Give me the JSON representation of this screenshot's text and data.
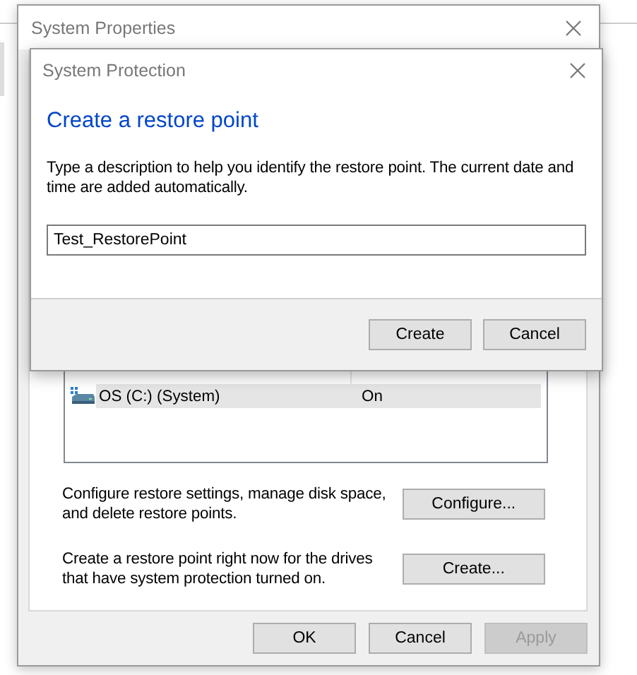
{
  "system_properties": {
    "title": "System Properties",
    "drives_table": {
      "rows": [
        {
          "drive": "OS (C:) (System)",
          "protection": "On",
          "selected": true
        }
      ]
    },
    "configure_text": "Configure restore settings, manage disk space, and delete restore points.",
    "configure_button": "Configure...",
    "create_text": "Create a restore point right now for the drives that have system protection turned on.",
    "create_button": "Create...",
    "buttons": [
      {
        "label": "OK",
        "disabled": false
      },
      {
        "label": "Cancel",
        "disabled": false
      },
      {
        "label": "Apply",
        "disabled": true
      }
    ]
  },
  "dialog": {
    "title": "System Protection",
    "heading": "Create a restore point",
    "description": "Type a description to help you identify the restore point. The current date and time are added automatically.",
    "description_field": {
      "value": "Test_RestorePoint"
    },
    "buttons": [
      {
        "label": "Create"
      },
      {
        "label": "Cancel"
      }
    ]
  }
}
